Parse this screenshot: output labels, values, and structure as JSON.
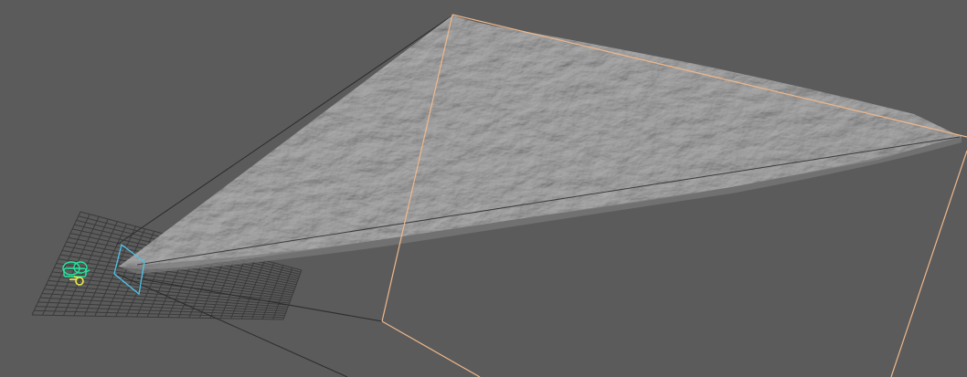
{
  "viewport": {
    "background": "#5b5b5b",
    "grid_color": "#3a3a3a",
    "surface_color": "#9a9a9a",
    "surface_shadow": "#7c7c7c",
    "bounding_box_color": "#f2b98a",
    "frustum_color": "#2e2e2e",
    "camera_icon_color": "#22e8a0",
    "light_icon_color": "#e8e84a",
    "camera_plane_color": "#4fc3e8"
  },
  "objects": [
    {
      "name": "terrain-surface",
      "type": "displaced-plane"
    },
    {
      "name": "camera",
      "type": "camera",
      "icon": "camera-icon"
    },
    {
      "name": "light",
      "type": "light",
      "icon": "light-icon"
    },
    {
      "name": "image-plane",
      "type": "camera-image-plane"
    },
    {
      "name": "bounding-box",
      "type": "selection-bbox"
    },
    {
      "name": "ground-grid",
      "type": "grid"
    }
  ]
}
